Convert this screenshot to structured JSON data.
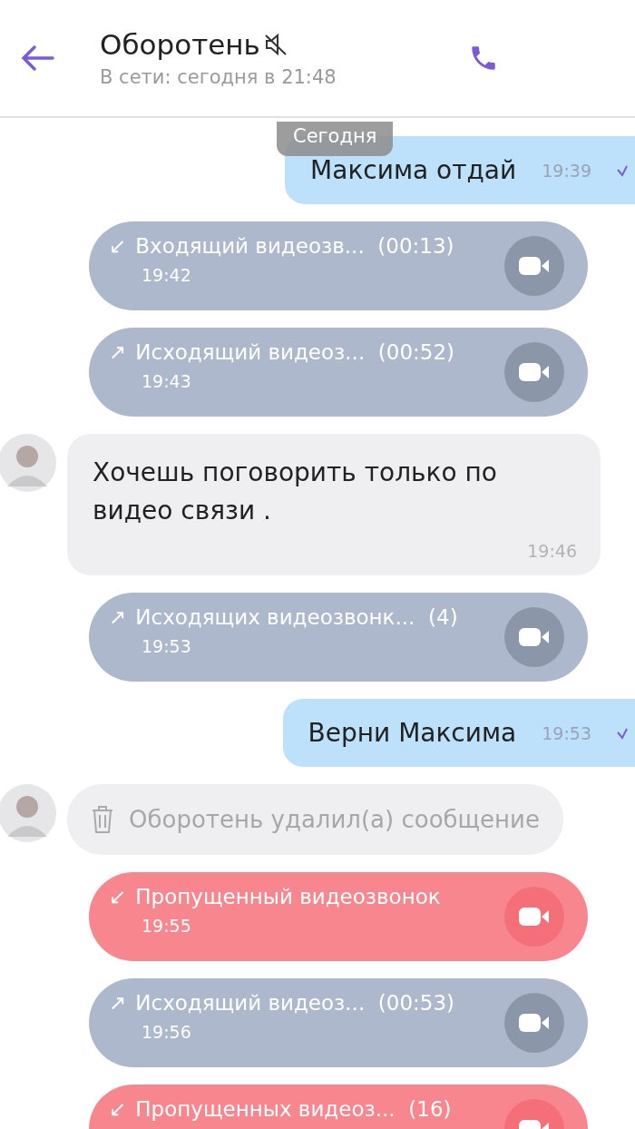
{
  "header": {
    "title": "Оборотень",
    "muted": true,
    "status": "В сети: сегодня в 21:48"
  },
  "date_chip": "Сегодня",
  "messages": [
    {
      "kind": "outgoing",
      "text": "Максима отдай",
      "time": "19:39",
      "read": true
    },
    {
      "kind": "call",
      "missed": false,
      "arrow": "↙",
      "text": "Входящий видеозв...  (00:13)",
      "time": "19:42"
    },
    {
      "kind": "call",
      "missed": false,
      "arrow": "↗",
      "text": "Исходящий видеоз...  (00:52)",
      "time": "19:43"
    },
    {
      "kind": "incoming",
      "text": "Хочешь поговорить только по видео связи .",
      "time": "19:46",
      "avatar": true
    },
    {
      "kind": "call",
      "missed": false,
      "arrow": "↗",
      "text": "Исходящих видеозвонк...  (4)",
      "time": "19:53"
    },
    {
      "kind": "outgoing",
      "text": "Верни Максима",
      "time": "19:53",
      "read": true
    },
    {
      "kind": "deleted",
      "text": "Оборотень удалил(а) сообщение",
      "avatar": true
    },
    {
      "kind": "call",
      "missed": true,
      "arrow": "↙",
      "text": "Пропущенный видеозвонок",
      "time": "19:55"
    },
    {
      "kind": "call",
      "missed": false,
      "arrow": "↗",
      "text": "Исходящий видеоз...  (00:53)",
      "time": "19:56"
    },
    {
      "kind": "call",
      "missed": true,
      "arrow": "↙",
      "text": "Пропущенных видеоз...  (16)"
    }
  ]
}
